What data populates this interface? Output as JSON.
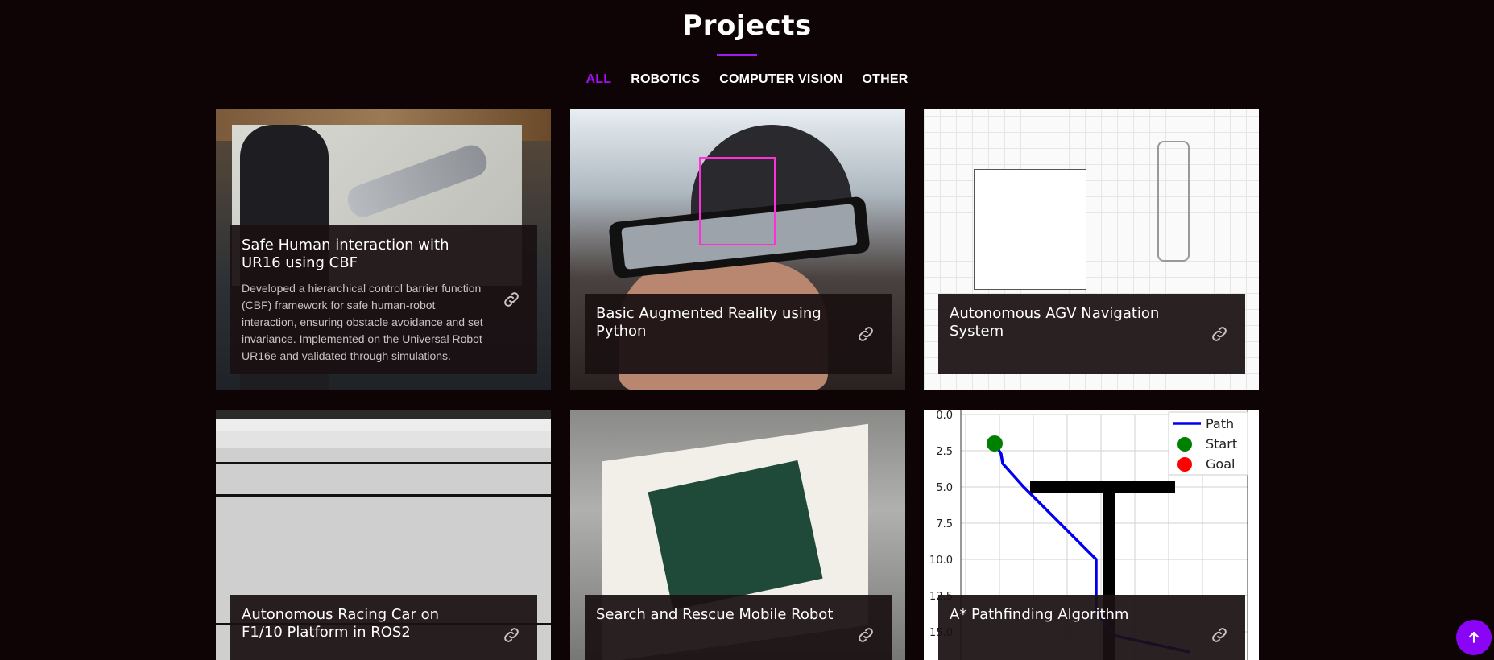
{
  "section": {
    "title": "Projects"
  },
  "filters": [
    {
      "label": "ALL",
      "active": true
    },
    {
      "label": "ROBOTICS",
      "active": false
    },
    {
      "label": "COMPUTER VISION",
      "active": false
    },
    {
      "label": "OTHER",
      "active": false
    }
  ],
  "projects": [
    {
      "title": "Safe Human interaction with UR16 using CBF",
      "description": "Developed a hierarchical control barrier function (CBF) framework for safe human-robot interaction, ensuring obstacle avoidance and set invariance. Implemented on the Universal Robot UR16e and validated through simulations."
    },
    {
      "title": "Basic Augmented Reality using Python"
    },
    {
      "title": "Autonomous AGV Navigation System"
    },
    {
      "title": "Autonomous Racing Car on F1/10 Platform in ROS2"
    },
    {
      "title": "Search and Rescue Mobile Robot"
    },
    {
      "title": "A* Pathfinding Algorithm"
    }
  ],
  "plot": {
    "legend": [
      "Path",
      "Start",
      "Goal"
    ],
    "yticks": [
      "0.0",
      "2.5",
      "5.0",
      "7.5",
      "10.0",
      "12.5",
      "15.0"
    ]
  },
  "theme": {
    "accent": "#a10ff2",
    "background": "#0e0406"
  },
  "icons": {
    "card_link": "link-icon",
    "back_to_top": "arrow-up-icon"
  }
}
